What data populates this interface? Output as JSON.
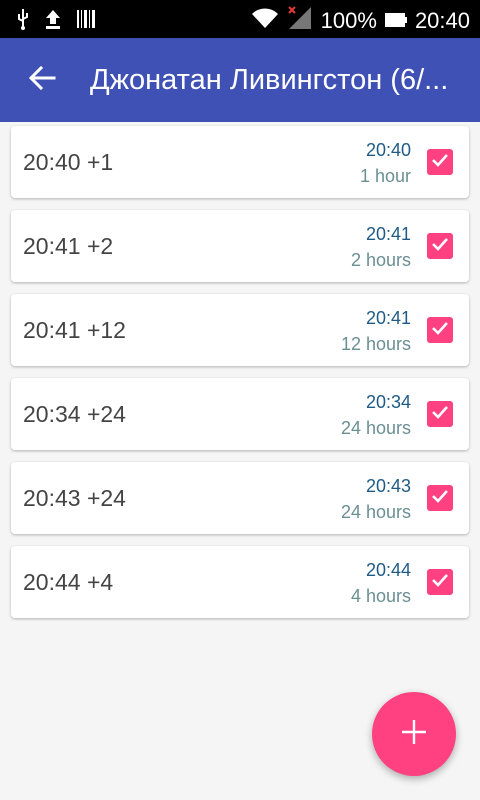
{
  "status_bar": {
    "battery": "100%",
    "time": "20:40",
    "icons": [
      "usb-icon",
      "upload-icon",
      "barcode-icon",
      "wifi-icon",
      "signal-icon",
      "battery-icon"
    ]
  },
  "app_bar": {
    "title": "Джонатан Ливингстон (6/...",
    "back_icon": "arrow-back-icon"
  },
  "items": [
    {
      "main": "20:40 +1",
      "time": "20:40",
      "duration": "1 hour",
      "checked": true
    },
    {
      "main": "20:41 +2",
      "time": "20:41",
      "duration": "2 hours",
      "checked": true
    },
    {
      "main": "20:41 +12",
      "time": "20:41",
      "duration": "12 hours",
      "checked": true
    },
    {
      "main": "20:34 +24",
      "time": "20:34",
      "duration": "24 hours",
      "checked": true
    },
    {
      "main": "20:43 +24",
      "time": "20:43",
      "duration": "24 hours",
      "checked": true
    },
    {
      "main": "20:44 +4",
      "time": "20:44",
      "duration": "4 hours",
      "checked": true
    }
  ],
  "fab": {
    "icon": "plus-icon"
  },
  "colors": {
    "primary": "#3f51b5",
    "accent": "#ff4081",
    "time_text": "#1e5b86",
    "duration_text": "#6a8f93"
  }
}
